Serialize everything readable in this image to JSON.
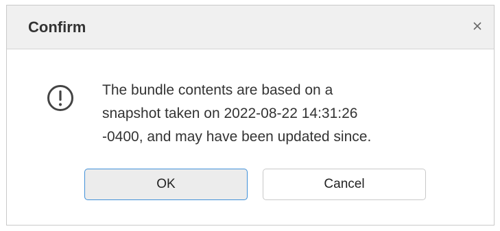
{
  "dialog": {
    "title": "Confirm",
    "close_icon": "close-icon",
    "message_icon": "exclamation-circle-icon",
    "message_lines": [
      "The bundle contents are based on a",
      "snapshot taken on 2022-08-22 14:31:26",
      "-0400, and may have been updated since."
    ],
    "buttons": {
      "ok_label": "OK",
      "cancel_label": "Cancel"
    },
    "colors": {
      "title_bar": "#f0f0f0",
      "primary_border": "#3f8fd8",
      "text": "#333333"
    }
  }
}
